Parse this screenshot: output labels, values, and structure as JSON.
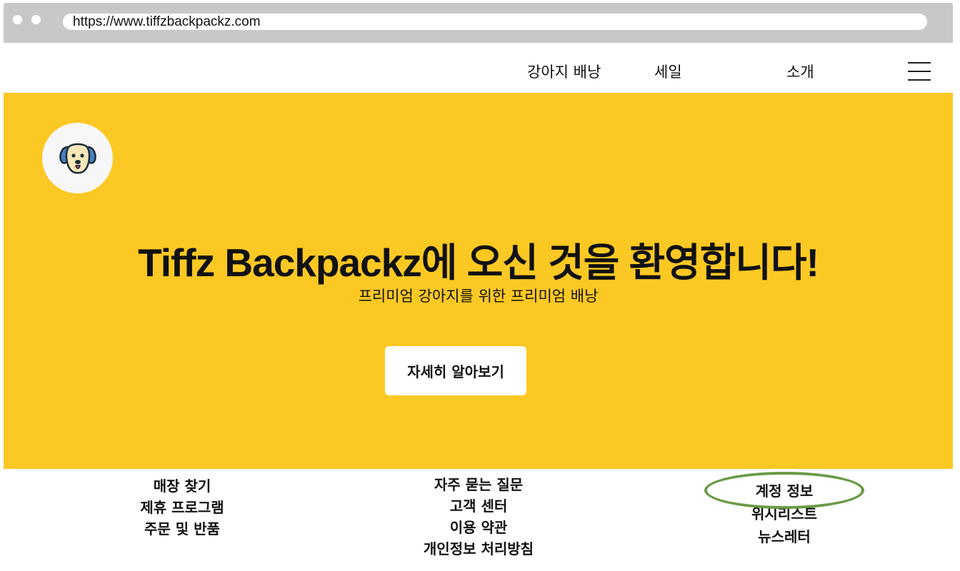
{
  "browser": {
    "url": "https://www.tiffzbackpackz.com"
  },
  "nav": {
    "items": [
      {
        "label": "강아지 배낭"
      },
      {
        "label": "세일"
      },
      {
        "label": "소개"
      }
    ],
    "menu_icon": "hamburger-menu-icon"
  },
  "hero": {
    "logo_icon": "dog-face-icon",
    "title": "Tiffz Backpackz에 오신 것을 환영합니다!",
    "subtitle": "프리미엄 강아지를 위한 프리미엄 배낭",
    "cta_label": "자세히 알아보기",
    "background_color": "#fcc823"
  },
  "footer": {
    "columns": [
      {
        "links": [
          "매장 찾기",
          "제휴 프로그램",
          "주문 및 반품"
        ]
      },
      {
        "links": [
          "자주 묻는 질문",
          "고객 센터",
          "이용 약관",
          "개인정보 처리방침"
        ]
      },
      {
        "links": [
          "계정 정보",
          "위시리스트",
          "뉴스레터"
        ]
      }
    ],
    "highlight_color": "#6a9a45"
  }
}
